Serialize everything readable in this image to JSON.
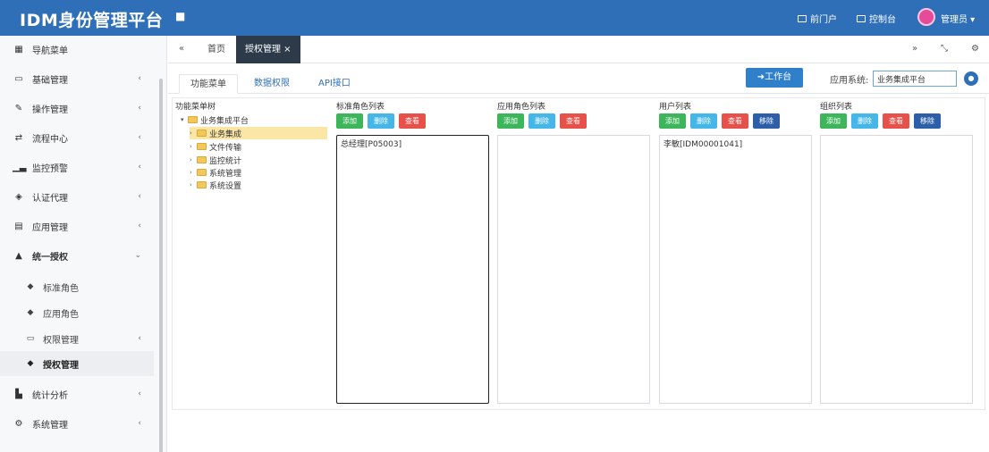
{
  "header": {
    "title": "IDM身份管理平台",
    "menu_icon": "menu-icon",
    "links": [
      {
        "label": "前门户",
        "icon": "portal-icon"
      },
      {
        "label": "控制台",
        "icon": "monitor-icon"
      }
    ],
    "user": "管理员 ▾",
    "colors": {
      "bar": "#2f6fb8",
      "avatar": "#e64a9a"
    }
  },
  "sidebar": {
    "items": [
      {
        "label": "导航菜单",
        "icon": "grid-icon",
        "chevron": ""
      },
      {
        "label": "基础管理",
        "icon": "card-icon",
        "chevron": "‹"
      },
      {
        "label": "操作管理",
        "icon": "pencil-icon",
        "chevron": "‹"
      },
      {
        "label": "流程中心",
        "icon": "flow-icon",
        "chevron": "‹"
      },
      {
        "label": "监控预警",
        "icon": "chart-icon",
        "chevron": "‹"
      },
      {
        "label": "认证代理",
        "icon": "shield-icon",
        "chevron": "‹"
      },
      {
        "label": "应用管理",
        "icon": "app-icon",
        "chevron": "‹"
      },
      {
        "label": "统一授权",
        "icon": "users-icon",
        "chevron": "⌄"
      }
    ],
    "subitems": [
      {
        "label": "标准角色",
        "icon": "tag-icon",
        "chevron": ""
      },
      {
        "label": "应用角色",
        "icon": "tag-icon",
        "chevron": ""
      },
      {
        "label": "权限管理",
        "icon": "folder-icon",
        "chevron": "‹"
      },
      {
        "label": "授权管理",
        "icon": "tag-icon",
        "chevron": ""
      }
    ],
    "bottom_items": [
      {
        "label": "统计分析",
        "icon": "bar-chart-icon",
        "chevron": "‹"
      },
      {
        "label": "系统管理",
        "icon": "gear-icon",
        "chevron": "‹"
      }
    ]
  },
  "tabbar": {
    "back": "«",
    "tabs": [
      {
        "label": "首页"
      },
      {
        "label": "授权管理 ×"
      }
    ],
    "right_icons": [
      "»",
      "⤡",
      "⚙"
    ]
  },
  "content": {
    "subtabs": [
      "功能菜单",
      "数据权限",
      "API接口"
    ],
    "workbench_button": "➜工作台",
    "app_system_label": "应用系统:",
    "app_system_value": "业务集成平台",
    "tree": {
      "title": "功能菜单树",
      "root": "业务集成平台",
      "children": [
        "业务集成",
        "文件传输",
        "监控统计",
        "系统管理",
        "系统设置"
      ]
    },
    "columns": [
      {
        "title": "标准角色列表",
        "buttons": [
          "添加",
          "删除",
          "查看"
        ],
        "entries": [
          "总经理[P05003]"
        ]
      },
      {
        "title": "应用角色列表",
        "buttons": [
          "添加",
          "删除",
          "查看"
        ],
        "entries": []
      },
      {
        "title": "用户列表",
        "buttons": [
          "添加",
          "删除",
          "查看",
          "移除"
        ],
        "entries": [
          "李敏[IDM00001041]"
        ]
      },
      {
        "title": "组织列表",
        "buttons": [
          "添加",
          "删除",
          "查看",
          "移除"
        ],
        "entries": []
      }
    ]
  }
}
